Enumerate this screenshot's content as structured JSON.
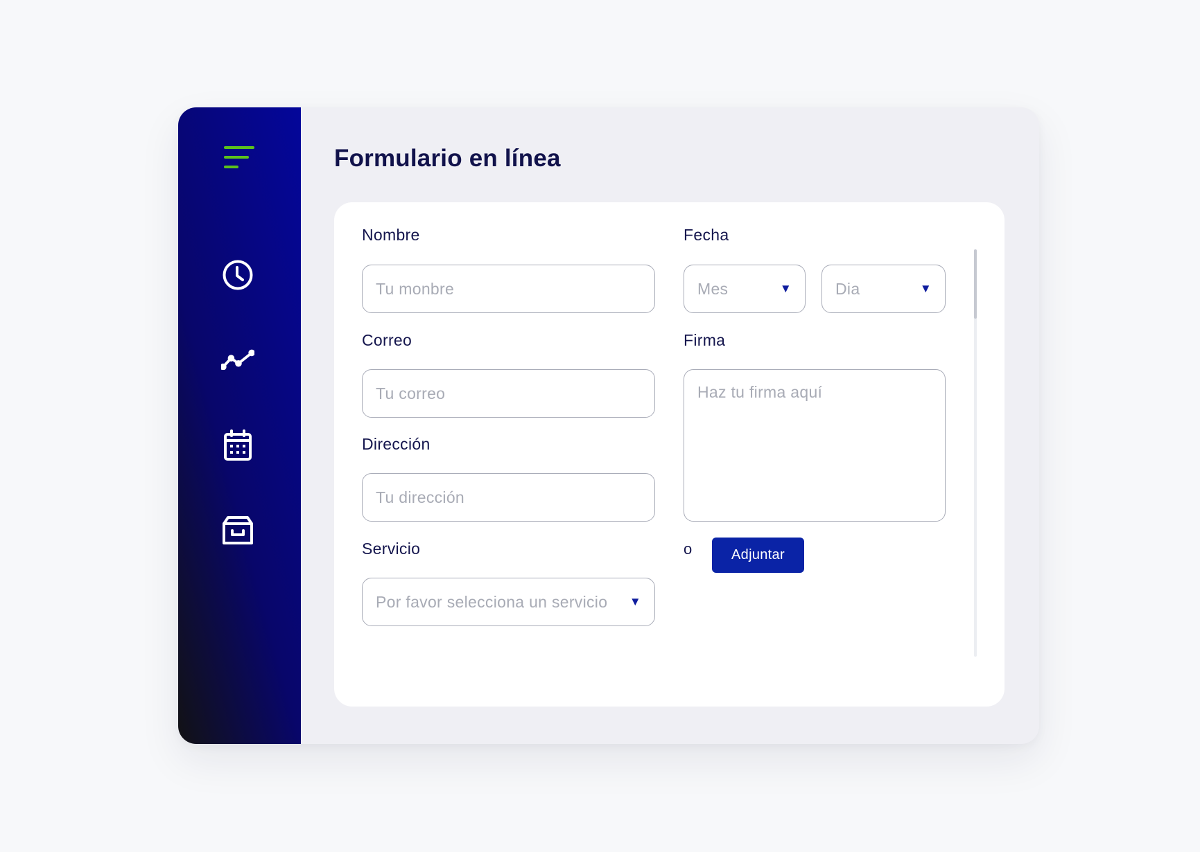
{
  "colors": {
    "accent": "#0a23a6",
    "menu_icon": "#5cc21c",
    "title": "#11124b",
    "caret": "#0f1d9e"
  },
  "sidebar": {
    "menu_icon": "menu-icon",
    "items": [
      {
        "icon": "clock-icon"
      },
      {
        "icon": "chart-line-icon"
      },
      {
        "icon": "calendar-icon"
      },
      {
        "icon": "archive-icon"
      }
    ]
  },
  "page": {
    "title": "Formulario en línea"
  },
  "form": {
    "name": {
      "label": "Nombre",
      "placeholder": "Tu monbre",
      "value": ""
    },
    "email": {
      "label": "Correo",
      "placeholder": "Tu correo",
      "value": ""
    },
    "address": {
      "label": "Dirección",
      "placeholder": "Tu dirección",
      "value": ""
    },
    "service": {
      "label": "Servicio",
      "selected": "Por favor selecciona un servicio"
    },
    "date": {
      "label": "Fecha",
      "month": "Mes",
      "day": "Dia"
    },
    "signature": {
      "label": "Firma",
      "placeholder": "Haz tu firma aquí",
      "value": ""
    },
    "or_text": "o",
    "attach_label": "Adjuntar"
  }
}
